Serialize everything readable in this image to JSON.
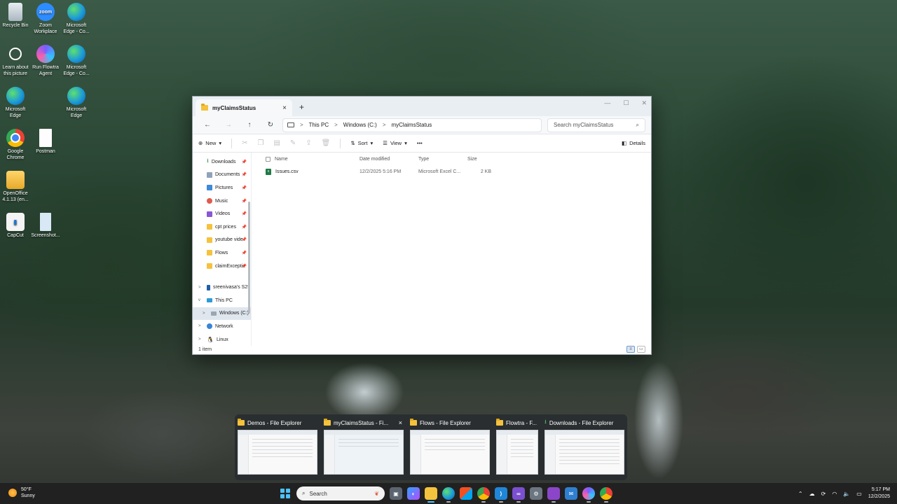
{
  "desktop": {
    "icons": [
      {
        "label": "Recycle Bin",
        "icon": "recycle-bin-icon"
      },
      {
        "label": "Zoom Workplace",
        "icon": "zoom-icon",
        "glyph": "zoom"
      },
      {
        "label": "Microsoft Edge - Co...",
        "icon": "edge-icon"
      },
      {
        "label": "Learn about this picture",
        "icon": "learn-picture-icon"
      },
      {
        "label": "Run Flowtra Agent",
        "icon": "flowtra-icon"
      },
      {
        "label": "Microsoft Edge - Co...",
        "icon": "edge-icon"
      },
      {
        "label": "Microsoft Edge",
        "icon": "edge-icon"
      },
      {
        "label": "Microsoft Edge",
        "icon": "edge-icon"
      },
      {
        "label": "Google Chrome",
        "icon": "chrome-icon"
      },
      {
        "label": "Postman",
        "icon": "document-icon"
      },
      {
        "label": "OpenOffice 4.1.13 (en...",
        "icon": "openoffice-folder-icon"
      },
      {
        "label": "CapCut",
        "icon": "capcut-icon"
      },
      {
        "label": "Screenshot...",
        "icon": "screenshot-icon"
      }
    ]
  },
  "explorer": {
    "tab_title": "myClaimsStatus",
    "tab_close": "×",
    "new_tab": "+",
    "window_controls": {
      "minimize": "—",
      "maximize": "☐",
      "close": "✕"
    },
    "nav": {
      "back": "←",
      "forward": "→",
      "up": "↑",
      "refresh": "↻"
    },
    "breadcrumb": [
      "This PC",
      "Windows (C:)",
      "myClaimsStatus"
    ],
    "crumb_sep": ">",
    "search_placeholder": "Search myClaimsStatus",
    "toolbar": {
      "new": "New",
      "sort": "Sort",
      "view": "View",
      "more": "•••",
      "details": "Details"
    },
    "sidebar": [
      {
        "label": "Downloads",
        "icon": "download",
        "pinned": true
      },
      {
        "label": "Documents",
        "icon": "docs",
        "pinned": true
      },
      {
        "label": "Pictures",
        "icon": "pics",
        "pinned": true
      },
      {
        "label": "Music",
        "icon": "music",
        "pinned": true
      },
      {
        "label": "Videos",
        "icon": "videos",
        "pinned": true
      },
      {
        "label": "cpt prices",
        "icon": "folder",
        "pinned": true
      },
      {
        "label": "youtube vide",
        "icon": "folder",
        "pinned": true
      },
      {
        "label": "Flows",
        "icon": "folder",
        "pinned": true
      },
      {
        "label": "claimExceptic",
        "icon": "folder",
        "pinned": true
      }
    ],
    "sidebar_tree": [
      {
        "label": "sreenivasa's S25",
        "icon": "phone",
        "chevron": ">"
      },
      {
        "label": "This PC",
        "icon": "pc",
        "chevron": "v"
      },
      {
        "label": "Windows (C:)",
        "icon": "drive",
        "chevron": ">",
        "selected": true
      },
      {
        "label": "Network",
        "icon": "net",
        "chevron": ">"
      },
      {
        "label": "Linux",
        "icon": "linux",
        "chevron": ">"
      }
    ],
    "pin_glyph": "📌",
    "columns": {
      "name": "Name",
      "date": "Date modified",
      "type": "Type",
      "size": "Size"
    },
    "files": [
      {
        "name": "Issues.csv",
        "date": "12/2/2025 5:16 PM",
        "type": "Microsoft Excel C...",
        "size": "2 KB"
      }
    ],
    "status": "1 item"
  },
  "previews": [
    {
      "title": "Demos - File Explorer",
      "icon": "folder"
    },
    {
      "title": "myClaimsStatus - Fi...",
      "icon": "folder",
      "active": true,
      "close": "×"
    },
    {
      "title": "Flows - File Explorer",
      "icon": "folder"
    },
    {
      "title": "Flowtra - F...",
      "icon": "folder"
    },
    {
      "title": "Downloads - File Explorer",
      "icon": "download"
    }
  ],
  "taskbar": {
    "weather_temp": "50°F",
    "weather_desc": "Sunny",
    "search_placeholder": "Search",
    "time": "5:17 PM",
    "date": "12/2/2025"
  }
}
